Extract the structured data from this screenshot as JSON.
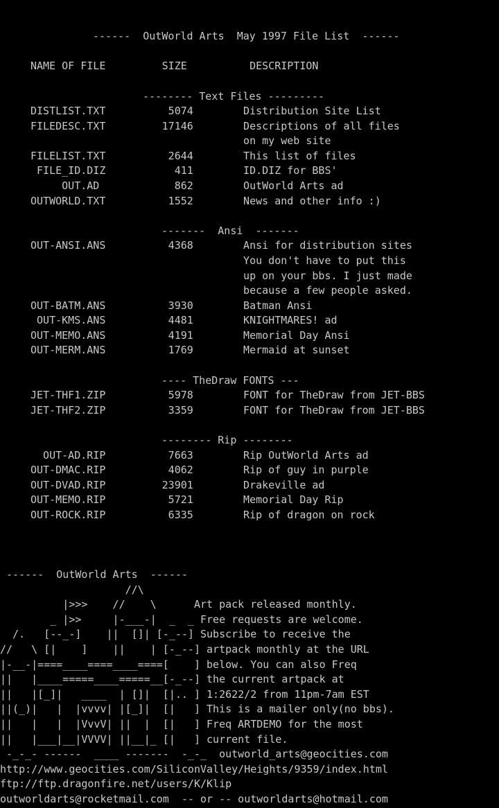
{
  "colors": {
    "background": "#000000",
    "text": "#c8c8c8"
  },
  "header": {
    "title": "------  OutWorld Arts  May 1997 File List  ------",
    "columns": "NAME OF FILE         SIZE          DESCRIPTION"
  },
  "sections": {
    "text_files": {
      "heading": "-------- Text Files ---------",
      "rows": [
        "DISTLIST.TXT          5074        Distribution Site List",
        "FILEDESC.TXT         17146        Descriptions of all files",
        "                                  on my web site",
        "FILELIST.TXT          2644        This list of files",
        " FILE_ID.DIZ           411        ID.DIZ for BBS'",
        "     OUT.AD            862        OutWorld Arts ad",
        "OUTWORLD.TXT          1552        News and other info :)"
      ]
    },
    "ansi": {
      "heading": "-------  Ansi  -------",
      "rows": [
        "OUT-ANSI.ANS          4368        Ansi for distribution sites",
        "                                  You don't have to put this",
        "                                  up on your bbs. I just made",
        "                                  because a few people asked.",
        "OUT-BATM.ANS          3930        Batman Ansi",
        " OUT-KMS.ANS          4481        KNIGHTMARES! ad",
        "OUT-MEMO.ANS          4191        Memorial Day Ansi",
        "OUT-MERM.ANS          1769        Mermaid at sunset"
      ]
    },
    "thedraw": {
      "heading": "---- TheDraw FONTS ---",
      "rows": [
        "JET-THF1.ZIP          5978        FONT for TheDraw from JET-BBS",
        "JET-THF2.ZIP          3359        FONT for TheDraw from JET-BBS"
      ]
    },
    "rip": {
      "heading": "-------- Rip --------",
      "rows": [
        "  OUT-AD.RIP          7663        Rip OutWorld Arts ad",
        "OUT-DMAC.RIP          4062        Rip of guy in purple",
        "OUT-DVAD.RIP         23901        Drakeville ad",
        "OUT-MEMO.RIP          5721        Memorial Day Rip",
        "OUT-ROCK.RIP          6335        Rip of dragon on rock"
      ]
    }
  },
  "footer": {
    "banner": " ------  OutWorld Arts  ------",
    "art_lines": [
      "                    //\\",
      "          |>>>    //    \\      Art pack released monthly.",
      "        _ |>>     |-___-|  _  _ Free requests are welcome.",
      "  /.   [--_-]    ||  []| [-_--] Subscribe to receive the",
      "//   \\ [|    ]    ||    | [-_--] artpack monthly at the URL",
      "|-__-|====____====____====[    ] below. You can also Freq",
      "||   |____=====____=====__[-_--] the current artpack at",
      "||   |[_]|   ____  | []|  [|.. ] 1:2622/2 from 11pm-7am EST",
      "||(_)|   |  |vvvv| |[_]|  [|   ] This is a mailer only(no bbs).",
      "||   |   |  |VvvV| ||  |  [|   ] Freq ARTDEMO for the most",
      "||   |___|__|VVVV| ||__|_ [|   ] current file.",
      " -_-_- ------  ____ -------  -_-_  outworld_arts@geocities.com"
    ],
    "links": [
      "http://www.geocities.com/SiliconValley/Heights/9359/index.html",
      "ftp://ftp.dragonfire.net/users/K/Klip",
      "outworldarts@rocketmail.com  -- or -- outworldarts@hotmail.com"
    ]
  }
}
